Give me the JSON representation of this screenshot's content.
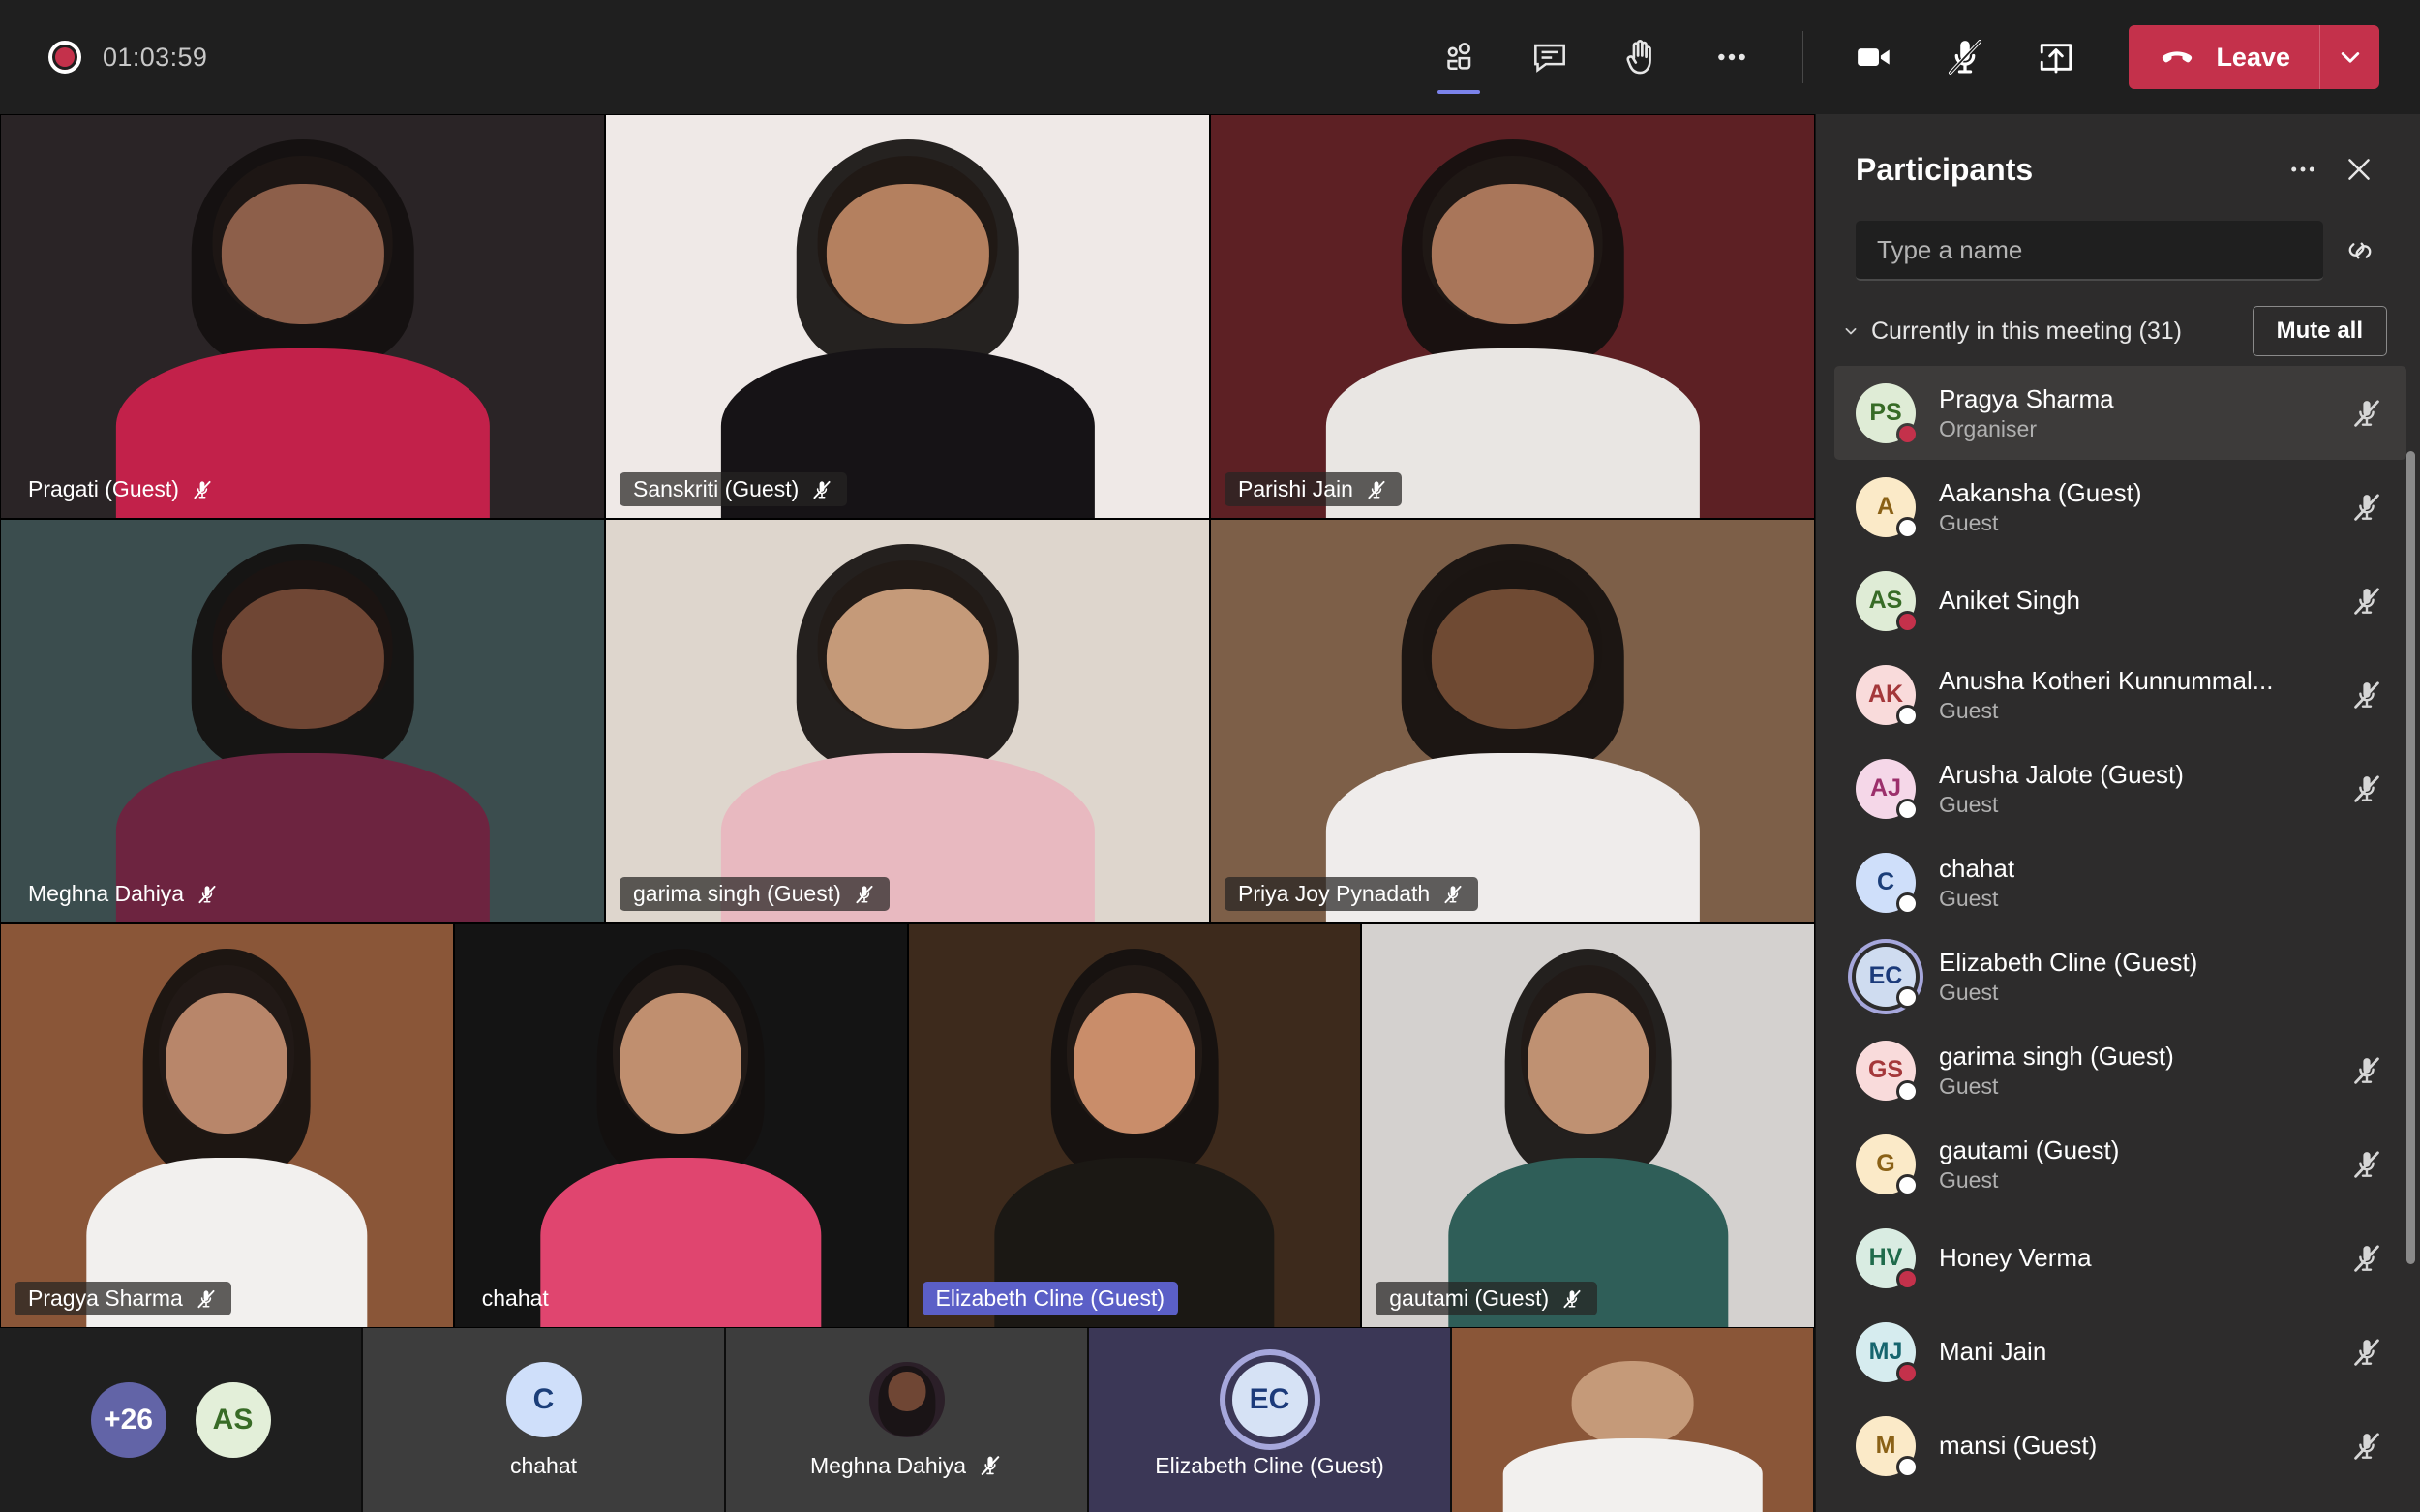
{
  "topbar": {
    "recording_time": "01:03:59",
    "recording_icon": "record-dot-icon",
    "buttons": [
      {
        "name": "people-icon",
        "label": "Show participants",
        "active": true
      },
      {
        "name": "chat-icon",
        "label": "Show conversation",
        "active": false
      },
      {
        "name": "raise-hand-icon",
        "label": "Raise hand",
        "active": false
      },
      {
        "name": "more-options-icon",
        "label": "More actions",
        "active": false
      }
    ],
    "controls": [
      {
        "name": "camera-icon",
        "label": "Turn camera off",
        "state": "on"
      },
      {
        "name": "microphone-muted-icon",
        "label": "Unmute",
        "state": "muted"
      },
      {
        "name": "share-screen-icon",
        "label": "Share content",
        "state": "off"
      }
    ],
    "leave": {
      "label": "Leave",
      "icon": "phone-hangup-icon",
      "caret_icon": "chevron-down-icon",
      "color": "#c4314b"
    }
  },
  "stage": {
    "rows": [
      [
        {
          "name": "Pragati (Guest)",
          "muted": true,
          "speaking": false,
          "label_style": "plain",
          "bg": "#1c1a1b",
          "skin": "#8d5f4a",
          "wall": "#2a2426",
          "shirt": "#c2214a"
        },
        {
          "name": "Sanskriti (Guest)",
          "muted": true,
          "speaking": false,
          "label_style": "chip",
          "bg": "#f0eaea",
          "skin": "#b4805f",
          "wall": "#efe9e7",
          "shirt": "#161316"
        },
        {
          "name": "Parishi Jain",
          "muted": true,
          "speaking": false,
          "label_style": "chip",
          "bg": "#5b1e22",
          "skin": "#a9765a",
          "wall": "#5d2024",
          "shirt": "#e9e6e3"
        }
      ],
      [
        {
          "name": "Meghna Dahiya",
          "muted": true,
          "speaking": false,
          "label_style": "plain",
          "bg": "#000000",
          "skin": "#6f4634",
          "wall": "#3b4d4e",
          "shirt": "#6d2440"
        },
        {
          "name": "garima singh (Guest)",
          "muted": true,
          "speaking": false,
          "label_style": "chip",
          "bg": "#d7cfc6",
          "skin": "#c59a79",
          "wall": "#ded6cd",
          "shirt": "#e8b9c0"
        },
        {
          "name": "Priya Joy Pynadath",
          "muted": true,
          "speaking": false,
          "label_style": "chip",
          "bg": "#8a6a50",
          "skin": "#6f4a33",
          "wall": "#7d5f48",
          "shirt": "#efeceb"
        }
      ],
      [
        {
          "name": "Pragya Sharma",
          "muted": true,
          "speaking": false,
          "label_style": "chip",
          "bg": "#7b4a33",
          "skin": "#b8866a",
          "wall": "#8a5638",
          "shirt": "#f2f0ee"
        },
        {
          "name": "chahat",
          "muted": false,
          "speaking": false,
          "label_style": "plain",
          "bg": "#000000",
          "skin": "#c08f6f",
          "wall": "#141414",
          "shirt": "#e0456f"
        },
        {
          "name": "Elizabeth Cline (Guest)",
          "muted": false,
          "speaking": true,
          "label_style": "speaking",
          "bg": "#2b1a12",
          "skin": "#c98d6a",
          "wall": "#3d2a1c",
          "shirt": "#1b1814"
        },
        {
          "name": "gautami (Guest)",
          "muted": true,
          "speaking": false,
          "label_style": "chip",
          "bg": "#cfcccb",
          "skin": "#bf9172",
          "wall": "#d4d1cf",
          "shirt": "#2f5e58"
        }
      ]
    ]
  },
  "filmstrip": [
    {
      "type": "overflow",
      "overflow_label": "+26",
      "overflow_color": "#6264a7",
      "avatar": {
        "initials": "AS",
        "bg": "#e3efd9",
        "fg": "#386b26"
      }
    },
    {
      "type": "avatar",
      "name": "chahat",
      "muted": false,
      "speaking": false,
      "avatar": {
        "initials": "C",
        "bg": "#cfdffa",
        "fg": "#1b3e79"
      }
    },
    {
      "type": "photo",
      "name": "Meghna Dahiya",
      "muted": true,
      "speaking": false,
      "photo": {
        "skin": "#6f4634",
        "hair": "#1a1416",
        "bg": "#2b1f28"
      }
    },
    {
      "type": "avatar",
      "name": "Elizabeth Cline (Guest)",
      "muted": false,
      "speaking": true,
      "avatar": {
        "initials": "EC",
        "bg": "#d6e2f5",
        "fg": "#1b3a7a"
      }
    },
    {
      "type": "video",
      "name": "",
      "muted": false,
      "speaking": false,
      "video": {
        "wall": "#8a5638",
        "skin": "#c59a79",
        "shirt": "#f2f0ee"
      }
    }
  ],
  "panel": {
    "title": "Participants",
    "more_icon": "more-options-icon",
    "close_icon": "close-icon",
    "search": {
      "placeholder": "Type a name",
      "value": "",
      "share_icon": "share-link-icon"
    },
    "section": {
      "label": "Currently in this meeting (31)",
      "collapse_icon": "chevron-down-icon",
      "mute_all_label": "Mute all"
    },
    "participants": [
      {
        "name": "Pragya Sharma",
        "role": "Organiser",
        "initials": "PS",
        "avatar_bg": "#dfecd6",
        "avatar_fg": "#376b26",
        "presence": "#c4314b",
        "muted": true,
        "selected": true,
        "speaking": false
      },
      {
        "name": "Aakansha (Guest)",
        "role": "Guest",
        "initials": "A",
        "avatar_bg": "#fbeac8",
        "avatar_fg": "#8a6116",
        "presence": "#ffffff",
        "muted": true,
        "selected": false,
        "speaking": false
      },
      {
        "name": "Aniket Singh",
        "role": "",
        "initials": "AS",
        "avatar_bg": "#dfecd6",
        "avatar_fg": "#376b26",
        "presence": "#c4314b",
        "muted": true,
        "selected": false,
        "speaking": false
      },
      {
        "name": "Anusha Kotheri Kunnummal...",
        "role": "Guest",
        "initials": "AK",
        "avatar_bg": "#f9dbdb",
        "avatar_fg": "#a4373a",
        "presence": "#ffffff",
        "muted": true,
        "selected": false,
        "speaking": false
      },
      {
        "name": "Arusha Jalote (Guest)",
        "role": "Guest",
        "initials": "AJ",
        "avatar_bg": "#f5d7e8",
        "avatar_fg": "#9c2f6b",
        "presence": "#ffffff",
        "muted": true,
        "selected": false,
        "speaking": false
      },
      {
        "name": "chahat",
        "role": "Guest",
        "initials": "C",
        "avatar_bg": "#cfdffa",
        "avatar_fg": "#1b3e79",
        "presence": "#ffffff",
        "muted": false,
        "selected": false,
        "speaking": false
      },
      {
        "name": "Elizabeth Cline (Guest)",
        "role": "Guest",
        "initials": "EC",
        "avatar_bg": "#cfdcf0",
        "avatar_fg": "#1b3a7a",
        "presence": "#ffffff",
        "muted": false,
        "selected": false,
        "speaking": true
      },
      {
        "name": "garima singh (Guest)",
        "role": "Guest",
        "initials": "GS",
        "avatar_bg": "#f9dbdb",
        "avatar_fg": "#a4373a",
        "presence": "#ffffff",
        "muted": true,
        "selected": false,
        "speaking": false
      },
      {
        "name": "gautami (Guest)",
        "role": "Guest",
        "initials": "G",
        "avatar_bg": "#fbeac8",
        "avatar_fg": "#8a6116",
        "presence": "#ffffff",
        "muted": true,
        "selected": false,
        "speaking": false
      },
      {
        "name": "Honey Verma",
        "role": "",
        "initials": "HV",
        "avatar_bg": "#d9ece2",
        "avatar_fg": "#1f6b4b",
        "presence": "#c4314b",
        "muted": true,
        "selected": false,
        "speaking": false
      },
      {
        "name": "Mani Jain",
        "role": "",
        "initials": "MJ",
        "avatar_bg": "#d6ecef",
        "avatar_fg": "#16656e",
        "presence": "#c4314b",
        "muted": true,
        "selected": false,
        "speaking": false
      },
      {
        "name": "mansi (Guest)",
        "role": "",
        "initials": "M",
        "avatar_bg": "#fbeac8",
        "avatar_fg": "#8a6116",
        "presence": "#ffffff",
        "muted": true,
        "selected": false,
        "speaking": false
      }
    ]
  }
}
